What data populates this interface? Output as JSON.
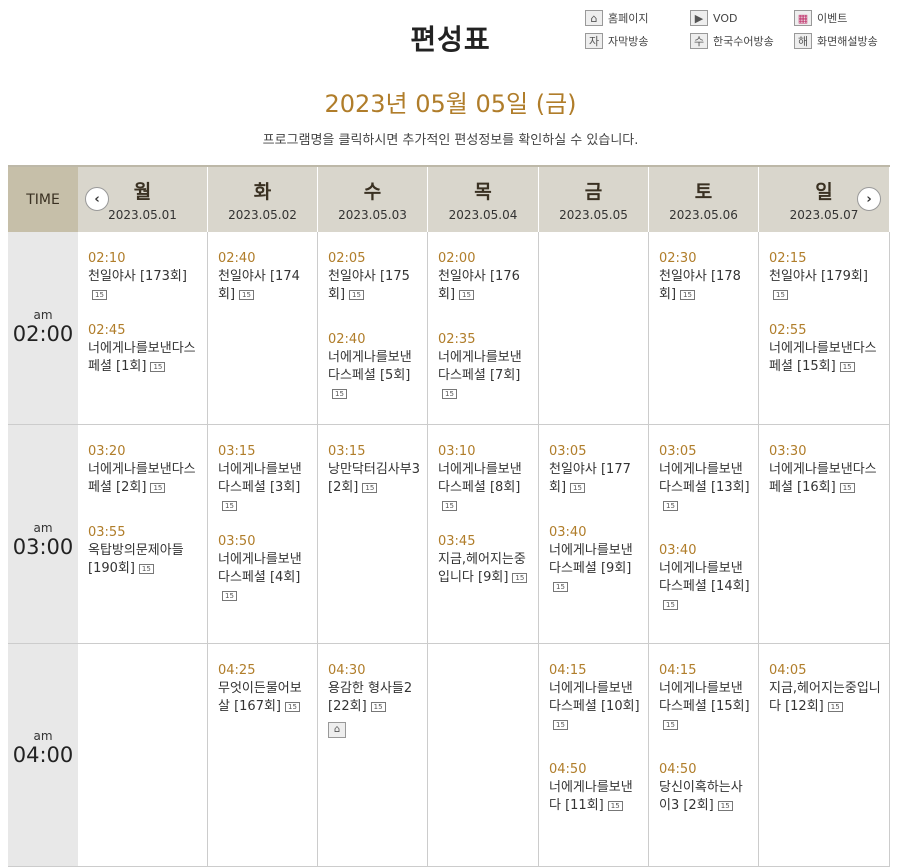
{
  "page_title": "편성표",
  "legend": [
    {
      "icon": "home-icon",
      "glyph": "⌂",
      "label": "홈페이지"
    },
    {
      "icon": "vod-icon",
      "glyph": "▶",
      "label": "VOD"
    },
    {
      "icon": "event-icon",
      "glyph": "▦",
      "label": "이벤트"
    },
    {
      "icon": "subtitle-icon",
      "glyph": "자",
      "label": "자막방송"
    },
    {
      "icon": "sign-language-icon",
      "glyph": "수",
      "label": "한국수어방송"
    },
    {
      "icon": "audio-description-icon",
      "glyph": "해",
      "label": "화면해설방송"
    }
  ],
  "current_date": "2023년 05월 05일 (금)",
  "instruction": "프로그램명을 클릭하시면 추가적인 편성정보를 확인하실 수 있습니다.",
  "time_header": "TIME",
  "prev_glyph": "‹",
  "next_glyph": "›",
  "days": [
    {
      "name": "월",
      "date": "2023.05.01"
    },
    {
      "name": "화",
      "date": "2023.05.02"
    },
    {
      "name": "수",
      "date": "2023.05.03"
    },
    {
      "name": "목",
      "date": "2023.05.04"
    },
    {
      "name": "금",
      "date": "2023.05.05"
    },
    {
      "name": "토",
      "date": "2023.05.06"
    },
    {
      "name": "일",
      "date": "2023.05.07"
    }
  ],
  "rating_badge": "15",
  "rows": [
    {
      "ampm": "am",
      "hour": "02:00",
      "cells": [
        [
          {
            "time": "02:10",
            "title": "천일야사 [173회]"
          },
          {
            "time": "02:45",
            "title": "너에게나를보낸다스페셜 [1회]"
          }
        ],
        [
          {
            "time": "02:40",
            "title": "천일야사 [174회]"
          }
        ],
        [
          {
            "time": "02:05",
            "title": "천일야사 [175회]"
          },
          {
            "time": "02:40",
            "title": "너에게나를보낸다스페셜 [5회]"
          }
        ],
        [
          {
            "time": "02:00",
            "title": "천일야사 [176회]"
          },
          {
            "time": "02:35",
            "title": "너에게나를보낸다스페셜 [7회]"
          }
        ],
        [],
        [
          {
            "time": "02:30",
            "title": "천일야사 [178회]"
          }
        ],
        [
          {
            "time": "02:15",
            "title": "천일야사 [179회]"
          },
          {
            "time": "02:55",
            "title": "너에게나를보낸다스페셜 [15회]"
          }
        ]
      ]
    },
    {
      "ampm": "am",
      "hour": "03:00",
      "cells": [
        [
          {
            "time": "03:20",
            "title": "너에게나를보낸다스페셜 [2회]"
          },
          {
            "time": "03:55",
            "title": "옥탑방의문제아들 [190회]"
          }
        ],
        [
          {
            "time": "03:15",
            "title": "너에게나를보낸다스페셜 [3회]"
          },
          {
            "time": "03:50",
            "title": "너에게나를보낸다스페셜 [4회]"
          }
        ],
        [
          {
            "time": "03:15",
            "title": "낭만닥터김사부3 [2회]"
          }
        ],
        [
          {
            "time": "03:10",
            "title": "너에게나를보낸다스페셜 [8회]"
          },
          {
            "time": "03:45",
            "title": "지금,헤어지는중입니다 [9회]"
          }
        ],
        [
          {
            "time": "03:05",
            "title": "천일야사 [177회]"
          },
          {
            "time": "03:40",
            "title": "너에게나를보낸다스페셜 [9회]"
          }
        ],
        [
          {
            "time": "03:05",
            "title": "너에게나를보낸다스페셜 [13회]"
          },
          {
            "time": "03:40",
            "title": "너에게나를보낸다스페셜 [14회]"
          }
        ],
        [
          {
            "time": "03:30",
            "title": "너에게나를보낸다스페셜 [16회]"
          }
        ]
      ]
    },
    {
      "ampm": "am",
      "hour": "04:00",
      "cells": [
        [],
        [
          {
            "time": "04:25",
            "title": "무엇이든물어보살 [167회]"
          }
        ],
        [
          {
            "time": "04:30",
            "title": "용감한 형사들2 [22회]",
            "home": true
          }
        ],
        [],
        [
          {
            "time": "04:15",
            "title": "너에게나를보낸다스페셜 [10회]"
          },
          {
            "time": "04:50",
            "title": "너에게나를보낸다 [11회]"
          }
        ],
        [
          {
            "time": "04:15",
            "title": "너에게나를보낸다스페셜 [15회]"
          },
          {
            "time": "04:50",
            "title": "당신이혹하는사이3 [2회]"
          }
        ],
        [
          {
            "time": "04:05",
            "title": "지금,헤어지는중입니다 [12회]"
          }
        ]
      ]
    }
  ]
}
